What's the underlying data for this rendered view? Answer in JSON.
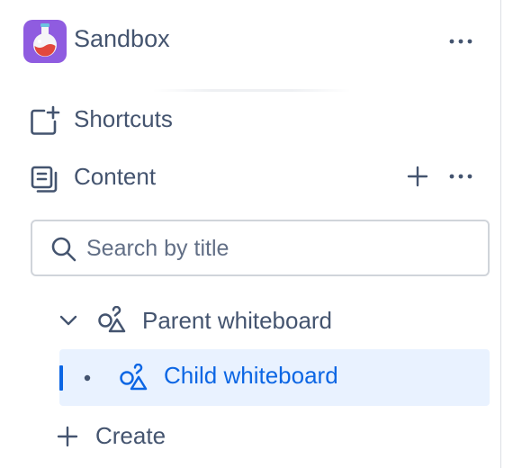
{
  "space": {
    "title": "Sandbox",
    "logo_icon": "potion-flask-icon",
    "more_icon": "more-horizontal-icon",
    "logo_color": "#8f5ce0"
  },
  "nav": {
    "shortcuts": {
      "label": "Shortcuts",
      "icon": "shortcut-add-icon"
    },
    "content": {
      "label": "Content",
      "icon": "pages-stack-icon",
      "add_icon": "plus-icon",
      "more_icon": "more-horizontal-icon"
    }
  },
  "search": {
    "placeholder": "Search by title",
    "value": "",
    "icon": "search-icon"
  },
  "tree": {
    "parent": {
      "label": "Parent whiteboard",
      "icon": "whiteboard-shapes-icon",
      "expand_icon": "chevron-down-icon"
    },
    "child": {
      "label": "Child whiteboard",
      "icon": "whiteboard-shapes-icon",
      "bullet_icon": "bullet-icon",
      "selected": true
    }
  },
  "create": {
    "label": "Create",
    "icon": "plus-icon"
  },
  "colors": {
    "text": "#44546f",
    "selected_text": "#0c66e4",
    "selected_bg": "#e9f2ff",
    "border": "#d0d4da"
  }
}
